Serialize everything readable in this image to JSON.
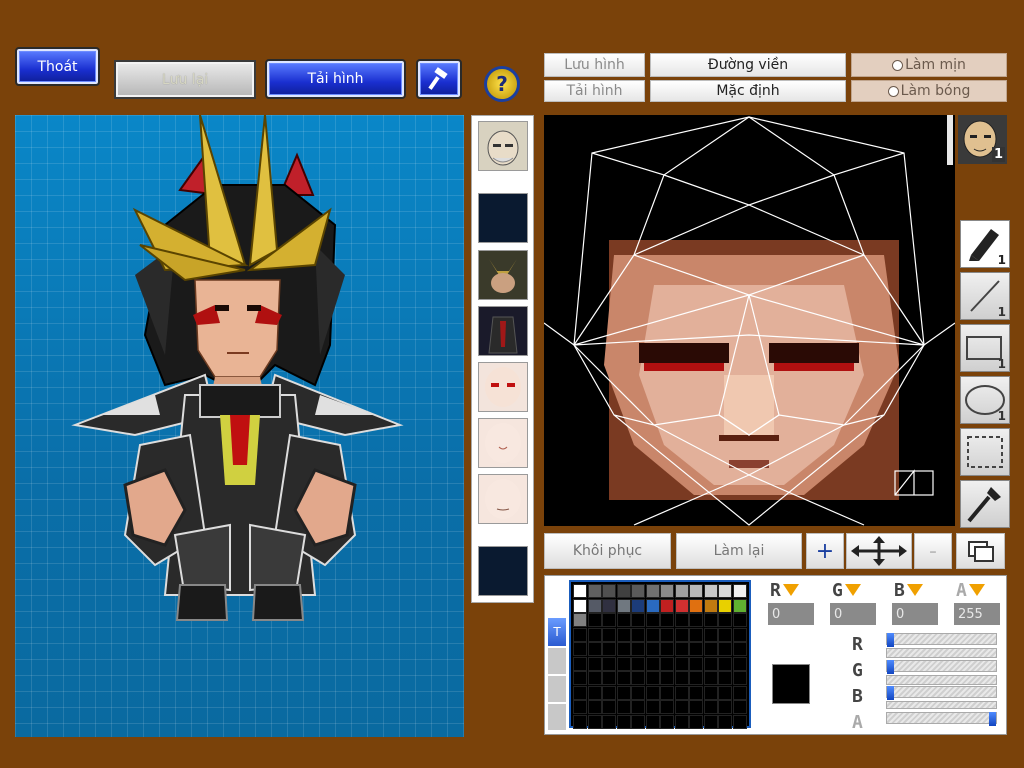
{
  "toolbar": {
    "exit_label": "Thoát",
    "save_label": "Lưu lại",
    "load_label": "Tải hình"
  },
  "tabs": {
    "save_image": "Lưu hình",
    "load_image": "Tải hình",
    "outline": "Đường viền",
    "default": "Mặc định",
    "smooth": "Làm mịn",
    "shade": "Làm bóng"
  },
  "bottom_buttons": {
    "restore": "Khôi phục",
    "redo": "Làm lại"
  },
  "tools": {
    "pen_count": "1",
    "line_count": "1",
    "rect_count": "1",
    "ellipse_count": "1",
    "face_badge": "1"
  },
  "color": {
    "r_label": "R",
    "g_label": "G",
    "b_label": "B",
    "a_label": "A",
    "r_value": "0",
    "g_value": "0",
    "b_value": "0",
    "a_value": "255",
    "r_fraction": 0,
    "g_fraction": 0,
    "b_fraction": 0,
    "a_fraction": 1,
    "selected_hex": "#000000"
  },
  "palette_colors": [
    "#ffffff",
    "#606060",
    "#505050",
    "#404040",
    "#5a5a5a",
    "#707070",
    "#8a8a8a",
    "#a0a0a0",
    "#b8b8b8",
    "#c8c8c8",
    "#d8d8d8",
    "#f0f0f0",
    "#ffffff",
    "#555a66",
    "#303040",
    "#707880",
    "#1c3c7a",
    "#2a6abf",
    "#c02020",
    "#d03030",
    "#e07010",
    "#c07a10",
    "#e8d000",
    "#60b030",
    "#808080"
  ],
  "palette_tab_label": "T",
  "icons": {
    "hammer": "hammer-icon",
    "help": "help-icon",
    "pen": "pen-icon",
    "line": "line-icon",
    "rect": "rectangle-icon",
    "ellipse": "ellipse-icon",
    "select": "selection-icon",
    "picker": "eyedropper-icon",
    "plus": "plus-icon",
    "move": "move-arrows-icon",
    "minus": "minus-icon",
    "layers": "layers-icon"
  }
}
